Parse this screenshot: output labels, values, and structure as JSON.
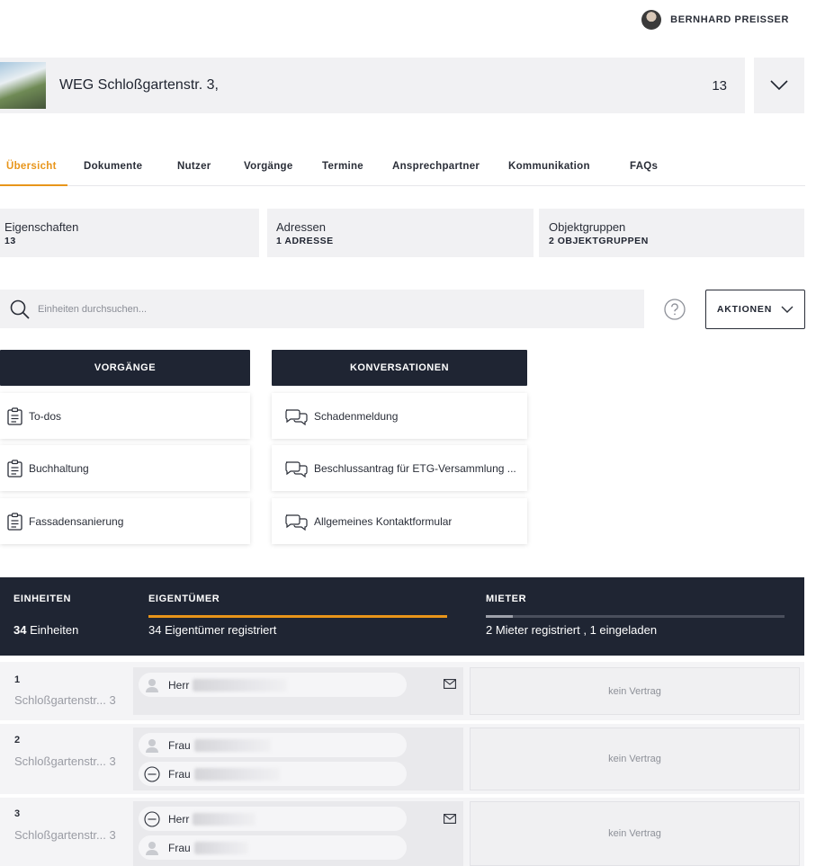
{
  "user": {
    "name": "BERNHARD PREISSER"
  },
  "property": {
    "title": "WEG Schloßgartenstr. 3,",
    "count": "13"
  },
  "tabs": [
    {
      "label": "Übersicht",
      "active": true
    },
    {
      "label": "Dokumente"
    },
    {
      "label": "Nutzer"
    },
    {
      "label": "Vorgänge"
    },
    {
      "label": "Termine"
    },
    {
      "label": "Ansprechpartner"
    },
    {
      "label": "Kommunikation"
    },
    {
      "label": "FAQs"
    }
  ],
  "summary": [
    {
      "title": "Eigenschaften",
      "value": "13"
    },
    {
      "title": "Adressen",
      "value": "1 ADRESSE"
    },
    {
      "title": "Objektgruppen",
      "value": "2 OBJEKTGRUPPEN"
    }
  ],
  "search": {
    "placeholder": "Einheiten durchsuchen..."
  },
  "actions_label": "AKTIONEN",
  "vorgaenge": {
    "header": "VORGÄNGE",
    "items": [
      "To-dos",
      "Buchhaltung",
      "Fassadensanierung"
    ]
  },
  "konversationen": {
    "header": "KONVERSATIONEN",
    "items": [
      "Schadenmeldung",
      "Beschlussantrag für ETG-Versammlung ...",
      "Allgemeines Kontaktformular"
    ]
  },
  "stats": {
    "einheiten_header": "EINHEITEN",
    "einheiten_count": "34",
    "einheiten_suffix": "Einheiten",
    "eigentuemer_header": "EIGENTÜMER",
    "eigentuemer_text": "34 Eigentümer registriert",
    "eigentuemer_progress": 1.0,
    "mieter_header": "MIETER",
    "mieter_text": "2 Mieter registriert , 1 eingeladen",
    "mieter_progress": 0.09
  },
  "units": [
    {
      "number": "1",
      "address": "Schloßgartenstr... 3",
      "owners": [
        {
          "salutation": "Herr",
          "status": "registered"
        }
      ],
      "tenant": "kein Vertrag"
    },
    {
      "number": "2",
      "address": "Schloßgartenstr... 3",
      "owners": [
        {
          "salutation": "Frau",
          "status": "registered"
        },
        {
          "salutation": "Frau",
          "status": "none"
        }
      ],
      "tenant": "kein Vertrag"
    },
    {
      "number": "3",
      "address": "Schloßgartenstr... 3",
      "owners": [
        {
          "salutation": "Herr",
          "status": "none"
        },
        {
          "salutation": "Frau",
          "status": "registered"
        }
      ],
      "tenant": "kein Vertrag"
    }
  ],
  "colors": {
    "accent": "#e8951a",
    "dark": "#1f2533"
  }
}
